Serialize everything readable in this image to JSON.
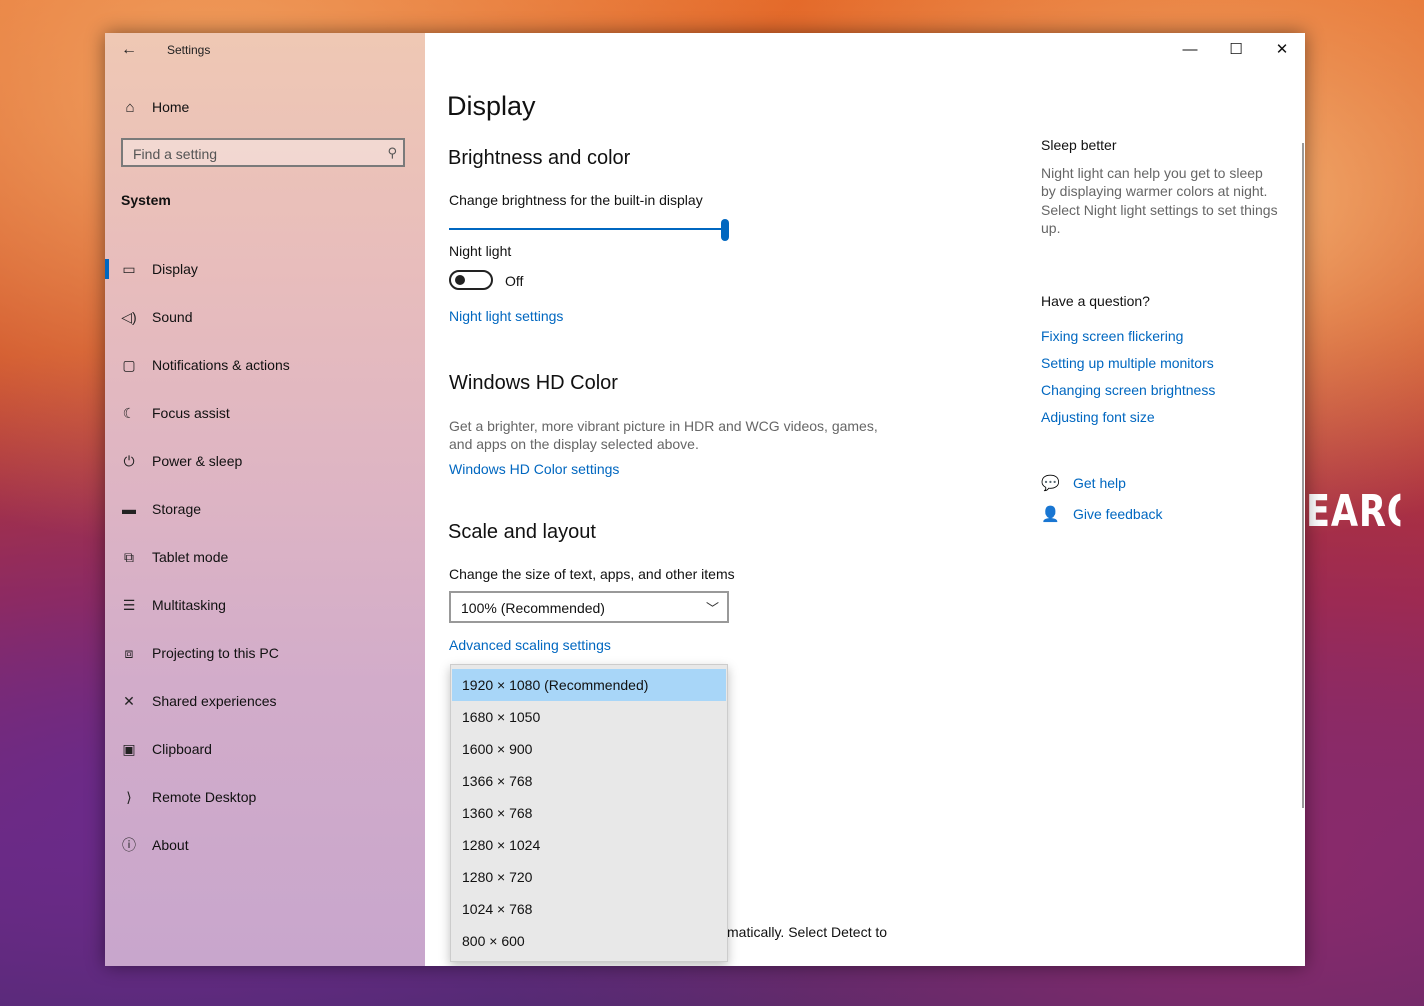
{
  "desktop": {
    "wallpaper_text": "EARCH O"
  },
  "window": {
    "title": "Settings",
    "controls": {
      "minimize": "—",
      "maximize": "☐",
      "close": "✕"
    }
  },
  "sidebar": {
    "home_label": "Home",
    "search_placeholder": "Find a setting",
    "section": "System",
    "items": [
      {
        "label": "Display",
        "icon": "monitor-icon",
        "glyph": "▭"
      },
      {
        "label": "Sound",
        "icon": "speaker-icon",
        "glyph": "◁)"
      },
      {
        "label": "Notifications & actions",
        "icon": "message-icon",
        "glyph": "▢"
      },
      {
        "label": "Focus assist",
        "icon": "moon-icon",
        "glyph": "☾"
      },
      {
        "label": "Power & sleep",
        "icon": "power-icon",
        "glyph": "⏻"
      },
      {
        "label": "Storage",
        "icon": "storage-icon",
        "glyph": "▬"
      },
      {
        "label": "Tablet mode",
        "icon": "tablet-icon",
        "glyph": "⧉"
      },
      {
        "label": "Multitasking",
        "icon": "multitasking-icon",
        "glyph": "☰"
      },
      {
        "label": "Projecting to this PC",
        "icon": "project-icon",
        "glyph": "⧈"
      },
      {
        "label": "Shared experiences",
        "icon": "share-icon",
        "glyph": "✕"
      },
      {
        "label": "Clipboard",
        "icon": "clipboard-icon",
        "glyph": "▣"
      },
      {
        "label": "Remote Desktop",
        "icon": "remote-icon",
        "glyph": "⟩"
      },
      {
        "label": "About",
        "icon": "info-icon",
        "glyph": "ⓘ"
      }
    ]
  },
  "main": {
    "page_title": "Display",
    "brightness": {
      "heading": "Brightness and color",
      "slider_label": "Change brightness for the built-in display",
      "slider_value_percent": 100,
      "night_light_label": "Night light",
      "night_light_state": "Off",
      "night_light_link": "Night light settings"
    },
    "hdr": {
      "heading": "Windows HD Color",
      "description_line1": "Get a brighter, more vibrant picture in HDR and WCG videos, games,",
      "description_line2": "and apps on the display selected above.",
      "link": "Windows HD Color settings"
    },
    "scale": {
      "heading": "Scale and layout",
      "label": "Change the size of text, apps, and other items",
      "selected": "100% (Recommended)",
      "advanced_link": "Advanced scaling settings"
    },
    "resolution_options": [
      "1920 × 1080 (Recommended)",
      "1680 × 1050",
      "1600 × 900",
      "1366 × 768",
      "1360 × 768",
      "1280 × 1024",
      "1280 × 720",
      "1024 × 768",
      "800 × 600"
    ],
    "partial_text": "matically. Select Detect to"
  },
  "right": {
    "sleep_heading": "Sleep better",
    "sleep_text_1": "Night light can help you get to sleep",
    "sleep_text_2": "by displaying warmer colors at night.",
    "sleep_text_3": "Select Night light settings to set things",
    "sleep_text_4": "up.",
    "question_heading": "Have a question?",
    "links": [
      "Fixing screen flickering",
      "Setting up multiple monitors",
      "Changing screen brightness",
      "Adjusting font size"
    ],
    "get_help": "Get help",
    "give_feedback": "Give feedback"
  },
  "colors": {
    "accent": "#0067c0",
    "selected_option": "#a8d6f8"
  }
}
